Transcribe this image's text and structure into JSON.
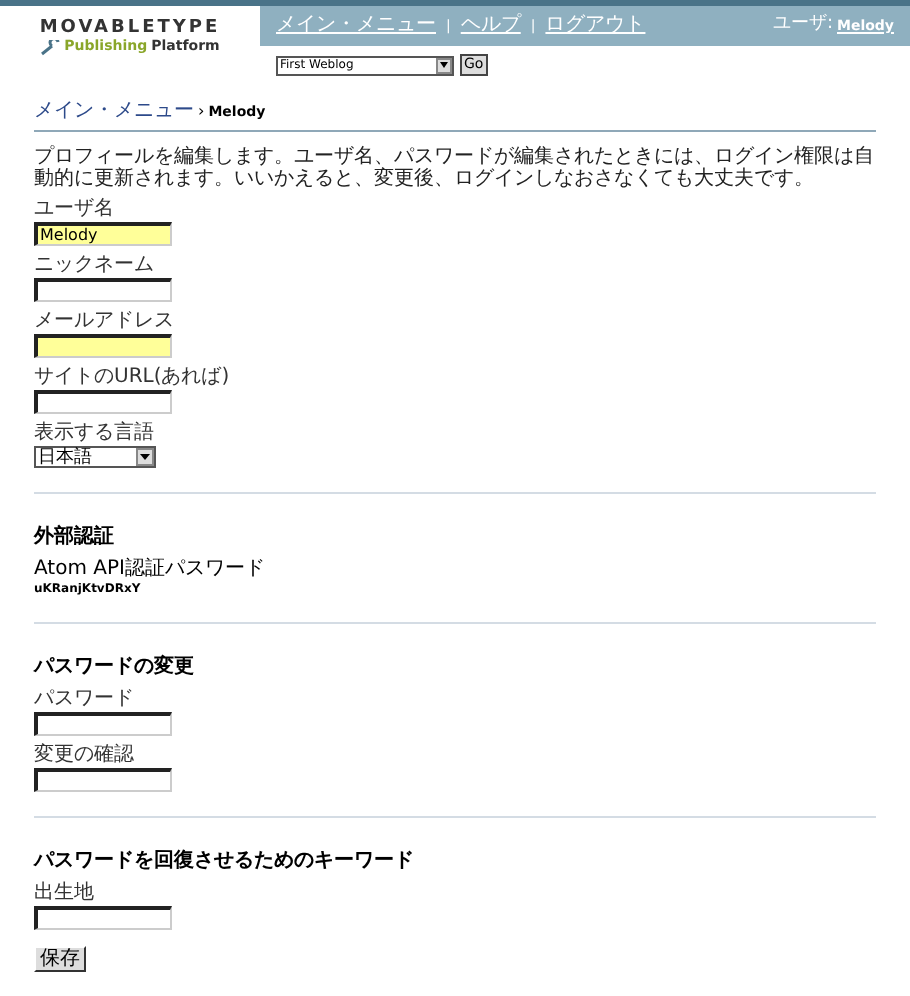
{
  "header": {
    "logo": {
      "title": "MOVABLETYPE",
      "subtitle_1": "Publishing",
      "subtitle_2": "Platform"
    },
    "nav": [
      {
        "kind": "link",
        "text": "メイン・メニュー"
      },
      {
        "kind": "separator",
        "text": "|"
      },
      {
        "kind": "link",
        "text": "ヘルプ"
      },
      {
        "kind": "separator",
        "text": "|"
      },
      {
        "kind": "link",
        "text": "ログアウト"
      }
    ],
    "user_label": "ユーザ:",
    "user_name": "Melody",
    "blog_select": "First Weblog",
    "go_button": "Go"
  },
  "breadcrumb": {
    "link": "メイン・メニュー",
    "separator": "›",
    "current": "Melody"
  },
  "intro": "プロフィールを編集します。ユーザ名、パスワードが編集されたときには、ログイン権限は自動的に更新されます。いいかえると、変更後、ログインしなおさなくても大丈夫です。",
  "profile_fields": [
    {
      "kind": "text",
      "label": "ユーザ名",
      "value": "Melody",
      "required": true
    },
    {
      "kind": "text",
      "label": "ニックネーム",
      "required": false
    },
    {
      "kind": "text",
      "label": "メールアドレス",
      "required": true
    },
    {
      "kind": "text",
      "label": "サイトのURL(あれば)",
      "required": false
    },
    {
      "kind": "select",
      "label": "表示する言語",
      "value": "日本語",
      "required": false
    }
  ],
  "external_auth": {
    "heading": "外部認証",
    "label": "Atom API認証パスワード",
    "value": "uKRanjKtvDRxY"
  },
  "password_change": {
    "heading": "パスワードの変更",
    "fields": [
      {
        "label": "パスワード"
      },
      {
        "label": "変更の確認"
      }
    ]
  },
  "recovery": {
    "heading": "パスワードを回復させるためのキーワード",
    "fields": [
      {
        "label": "出生地"
      }
    ]
  },
  "save_button": "保存"
}
